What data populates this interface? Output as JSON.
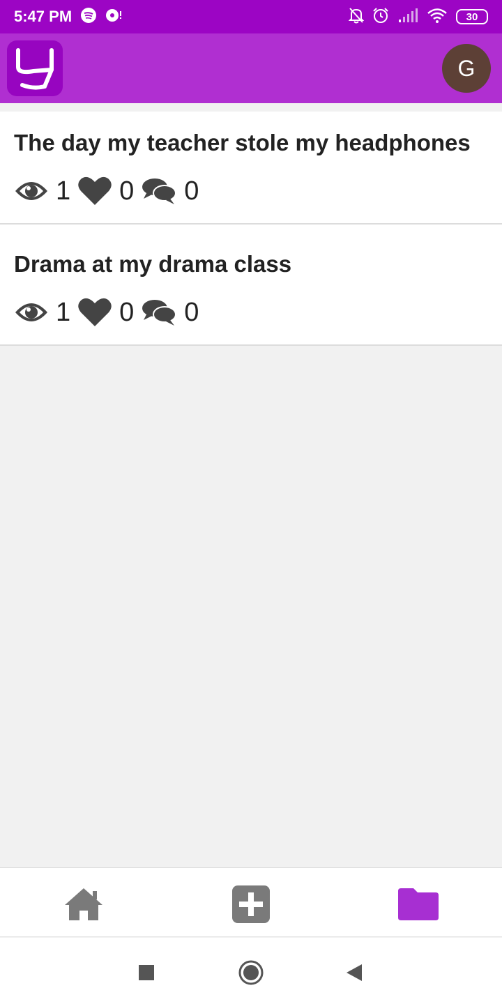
{
  "status_bar": {
    "time": "5:47 PM",
    "battery": "30",
    "icons": [
      "spotify-icon",
      "media-icon",
      "bell-off-icon",
      "alarm-icon",
      "signal-icon",
      "wifi-icon",
      "battery-icon"
    ]
  },
  "app_bar": {
    "logo": "app-logo",
    "avatar_letter": "G",
    "avatar_color": "#5d4036",
    "bar_color": "#b02fd1"
  },
  "stories": [
    {
      "title": "The day my teacher stole my headphones",
      "views": "1",
      "likes": "0",
      "comments": "0"
    },
    {
      "title": "Drama at my drama class",
      "views": "1",
      "likes": "0",
      "comments": "0"
    }
  ],
  "bottom_nav": {
    "items": [
      "home-icon",
      "add-icon",
      "folder-icon"
    ],
    "active": "folder-icon",
    "active_color": "#a72fd2"
  }
}
